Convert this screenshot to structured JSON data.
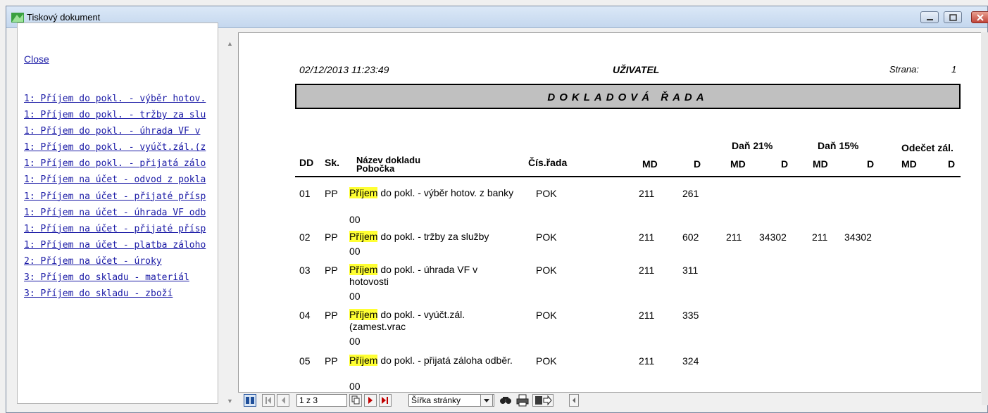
{
  "window": {
    "title": "Tiskový dokument"
  },
  "sidebar": {
    "close_label": "Close",
    "items": [
      "1: Příjem do pokl. - výběr hotov.",
      "1: Příjem do pokl. - tržby za slu",
      "1: Příjem do pokl. - úhrada VF v",
      "1: Příjem do pokl. - vyúčt.zál.(z",
      "1: Příjem do pokl. - přijatá zálo",
      "1: Příjem na účet - odvod z pokla",
      "1: Příjem na účet - přijaté přísp",
      "1: Příjem na účet - úhrada VF odb",
      "1: Příjem na účet - přijaté přísp",
      "1: Příjem na účet - platba záloho",
      "2: Příjem na účet - úroky",
      "3: Příjem do skladu - materiál",
      "3: Příjem do skladu - zboží"
    ]
  },
  "report": {
    "datetime": "02/12/2013  11:23:49",
    "user": "UŽIVATEL",
    "page_label": "Strana:",
    "page_number": "1",
    "band_title": "DOKLADOVÁ ŘADA",
    "headers": {
      "dd": "DD",
      "sk": "Sk.",
      "name": "Název dokladu",
      "branch": "Pobočka",
      "series": "Čís.řada",
      "md": "MD",
      "d": "D",
      "tax21": "Daň 21%",
      "tax15": "Daň 15%",
      "deduct": "Odečet zál.",
      "md21": "MD",
      "d21": "D",
      "md15": "MD",
      "d15": "D",
      "mdz": "MD",
      "dz": "D"
    },
    "rows": [
      {
        "dd": "01",
        "sk": "PP",
        "highlight": "Příjem",
        "rest": " do pokl. - výběr hotov. z banky",
        "branch": "00",
        "series": "POK",
        "md": "211",
        "d": "261",
        "md21": "",
        "d21": "",
        "md15": "",
        "d15": ""
      },
      {
        "dd": "02",
        "sk": "PP",
        "highlight": "Příjem",
        "rest": " do pokl. - tržby za služby",
        "branch": "00",
        "series": "POK",
        "md": "211",
        "d": "602",
        "md21": "211",
        "d21": "34302",
        "md15": "211",
        "d15": "34302"
      },
      {
        "dd": "03",
        "sk": "PP",
        "highlight": "Příjem",
        "rest": " do pokl. - úhrada VF v hotovosti",
        "branch": "00",
        "series": "POK",
        "md": "211",
        "d": "311",
        "md21": "",
        "d21": "",
        "md15": "",
        "d15": ""
      },
      {
        "dd": "04",
        "sk": "PP",
        "highlight": "Příjem",
        "rest": " do pokl. - vyúčt.zál. (zamest.vrac",
        "branch": "00",
        "series": "POK",
        "md": "211",
        "d": "335",
        "md21": "",
        "d21": "",
        "md15": "",
        "d15": ""
      },
      {
        "dd": "05",
        "sk": "PP",
        "highlight": "Příjem",
        "rest": " do pokl. - přijatá záloha odběr.",
        "branch": "00",
        "series": "POK",
        "md": "211",
        "d": "324",
        "md21": "",
        "d21": "",
        "md15": "",
        "d15": ""
      }
    ]
  },
  "toolbar": {
    "page_value": "1 z 3",
    "zoom_value": "Šířka stránky",
    "icons": [
      "toggle-tree-icon",
      "first-page-icon",
      "prev-page-icon",
      "copy-icon",
      "next-page-icon",
      "last-page-icon",
      "dropdown-arrow-icon",
      "find-icon",
      "print-icon",
      "export-icon",
      "scroll-left-icon"
    ]
  },
  "colors": {
    "highlight": "#ffff33",
    "band": "#c0c0c0",
    "link": "#1a1aa6",
    "arrow_red": "#c00000"
  }
}
